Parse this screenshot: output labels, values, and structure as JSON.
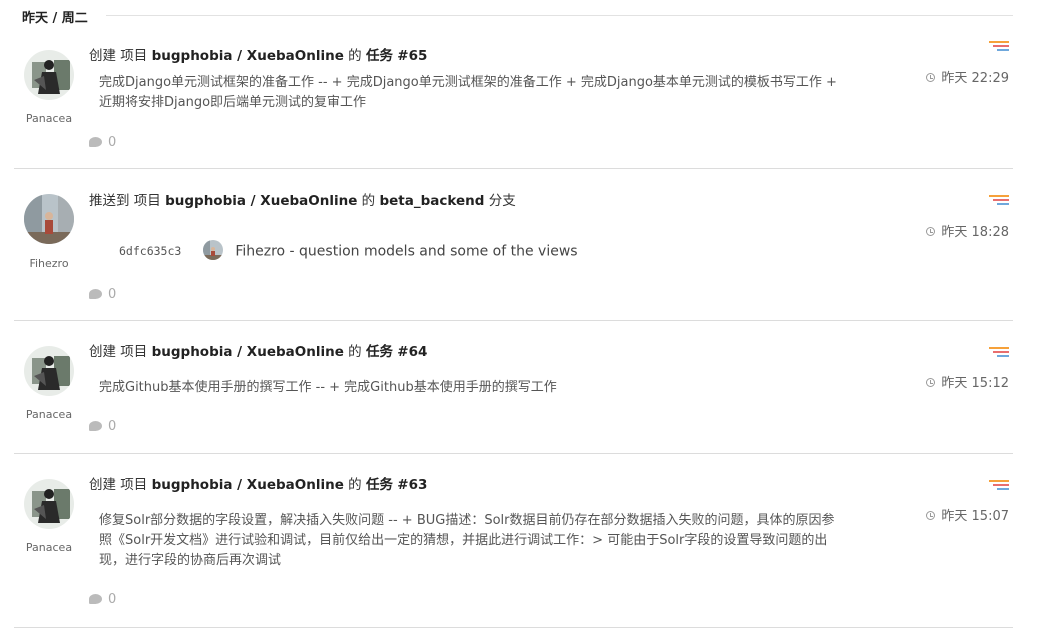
{
  "day_header": "昨天 / 周二",
  "colors": {
    "icon_bar_1": "#f6a13a",
    "icon_bar_2": "#e86e6e",
    "icon_bar_3": "#6fa8dc",
    "divider": "#dcdcdc"
  },
  "events": [
    {
      "user": "Panacea",
      "avatar_icon": "panacea-avatar",
      "action": "创建 项目",
      "project": "bugphobia / XuebaOnline",
      "of": "的",
      "target_type": "任务",
      "target": "#65",
      "description": "完成Django单元测试框架的准备工作 -- + 完成Django单元测试框架的准备工作 + 完成Django基本单元测试的模板书写工作 + 近期将安排Django即后端单元测试的复审工作",
      "time": "昨天 22:29",
      "comments": "0"
    },
    {
      "user": "Fihezro",
      "avatar_icon": "fihezro-avatar",
      "action": "推送到 项目",
      "project": "bugphobia / XuebaOnline",
      "of": "的",
      "target": "beta_backend",
      "target_type": "分支",
      "commit_hash": "6dfc635c3",
      "commit_message": "Fihezro - question models and some of the views",
      "time": "昨天 18:28",
      "comments": "0"
    },
    {
      "user": "Panacea",
      "avatar_icon": "panacea-avatar",
      "action": "创建 项目",
      "project": "bugphobia / XuebaOnline",
      "of": "的",
      "target_type": "任务",
      "target": "#64",
      "description": "完成Github基本使用手册的撰写工作 -- + 完成Github基本使用手册的撰写工作",
      "time": "昨天 15:12",
      "comments": "0"
    },
    {
      "user": "Panacea",
      "avatar_icon": "panacea-avatar",
      "action": "创建 项目",
      "project": "bugphobia / XuebaOnline",
      "of": "的",
      "target_type": "任务",
      "target": "#63",
      "description": "修复Solr部分数据的字段设置，解决插入失败问题 -- + BUG描述：Solr数据目前仍存在部分数据插入失败的问题，具体的原因参照《Solr开发文档》进行试验和调试，目前仅给出一定的猜想，并据此进行调试工作：> 可能由于Solr字段的设置导致问题的出现，进行字段的协商后再次调试",
      "time": "昨天 15:07",
      "comments": "0"
    }
  ]
}
